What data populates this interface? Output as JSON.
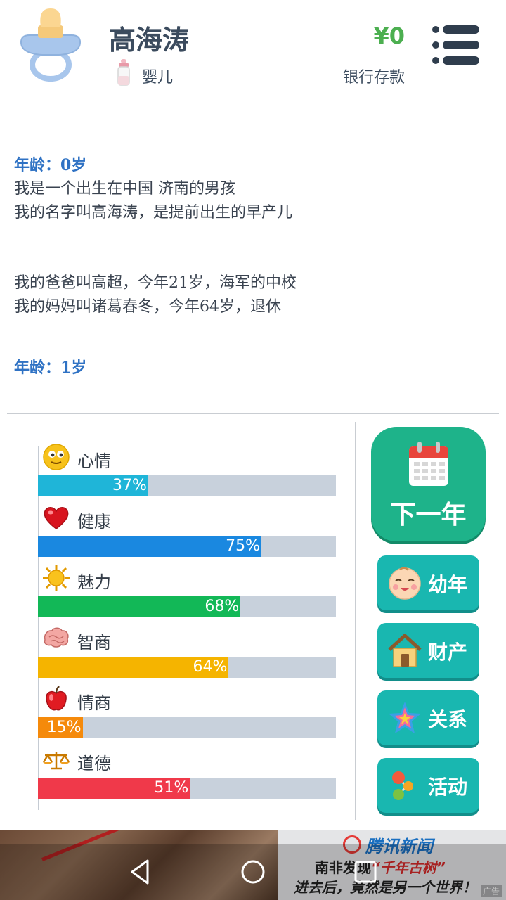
{
  "header": {
    "name": "高海涛",
    "stage": "婴儿",
    "money": "¥0",
    "money_label": "银行存款"
  },
  "log": {
    "entries": [
      {
        "age_label": "年龄：0岁",
        "lines": [
          "我是一个出生在中国 济南的男孩",
          "我的名字叫高海涛，是提前出生的早产儿"
        ],
        "family": [
          "我的爸爸叫高超，今年21岁，海军的中校",
          "我的妈妈叫诸葛春冬，今年64岁，退休"
        ]
      },
      {
        "age_label": "年龄：1岁"
      }
    ]
  },
  "stats": [
    {
      "label": "心情",
      "value": 37,
      "text": "37%",
      "color": "#1fb5d8",
      "icon": "smiley-icon"
    },
    {
      "label": "健康",
      "value": 75,
      "text": "75%",
      "color": "#1a88e0",
      "icon": "heart-icon"
    },
    {
      "label": "魅力",
      "value": 68,
      "text": "68%",
      "color": "#12b857",
      "icon": "sun-icon"
    },
    {
      "label": "智商",
      "value": 64,
      "text": "64%",
      "color": "#f5b400",
      "icon": "brain-icon"
    },
    {
      "label": "情商",
      "value": 15,
      "text": "15%",
      "color": "#f58a0b",
      "icon": "apple-icon"
    },
    {
      "label": "道德",
      "value": 51,
      "text": "51%",
      "color": "#f0394a",
      "icon": "scales-icon"
    }
  ],
  "actions": {
    "next_year": "下一年",
    "childhood": "幼年",
    "property": "财产",
    "relations": "关系",
    "activities": "活动"
  },
  "ad": {
    "brand": "腾讯新闻",
    "line1_a": "南非发现",
    "line1_b": "“千年古树”",
    "line2": "进去后，竟然是另一个世界！",
    "tag": "广告"
  }
}
